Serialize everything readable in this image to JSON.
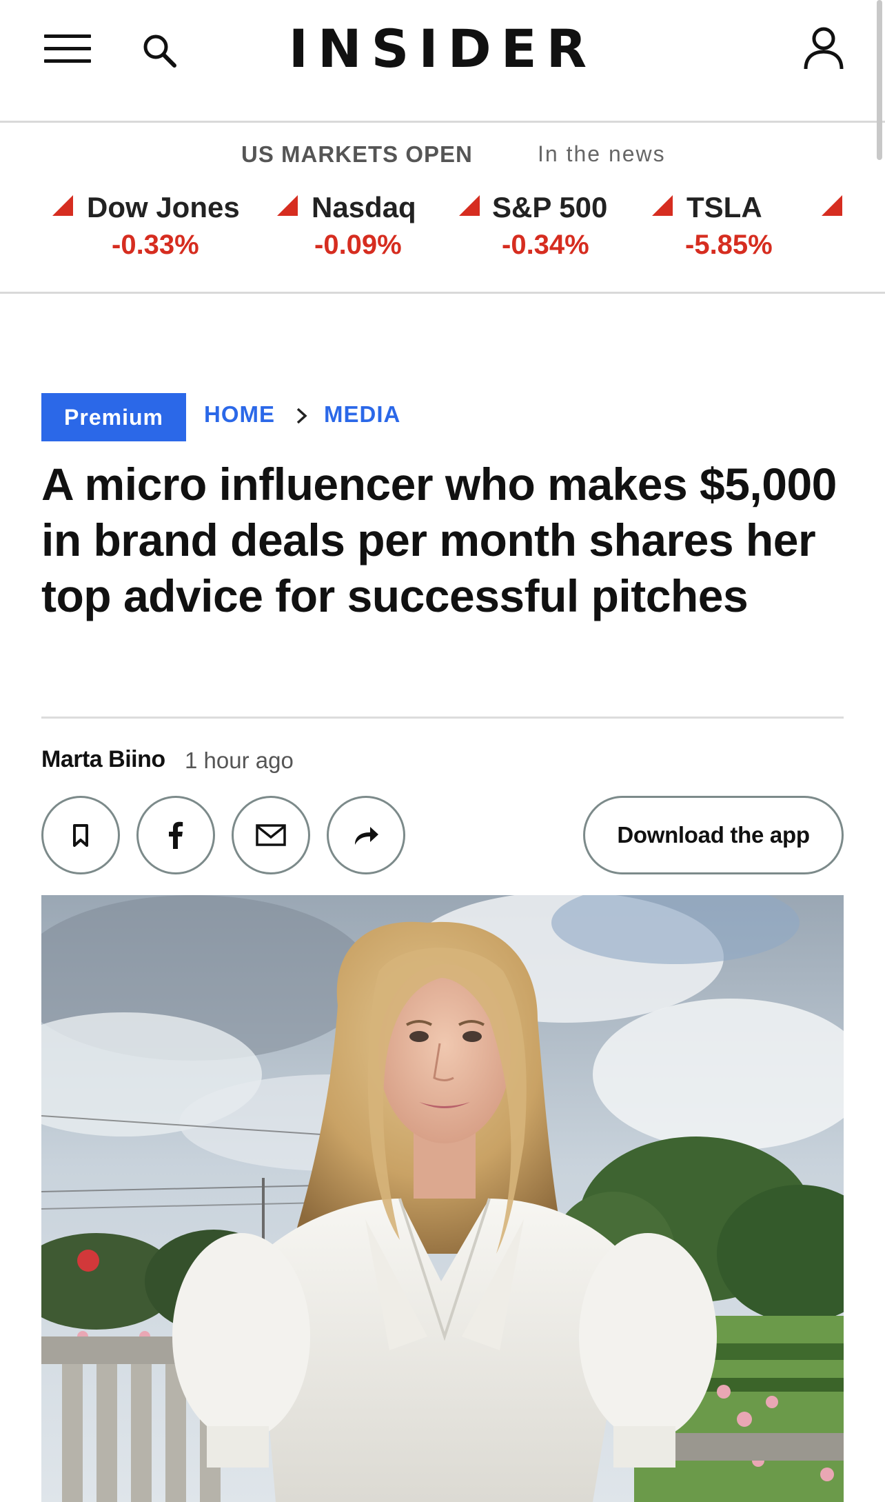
{
  "header": {
    "logo_text": "INSIDER",
    "menu_icon": "hamburger-menu-icon",
    "search_icon": "search-icon",
    "account_icon": "user-account-icon"
  },
  "markets": {
    "status": "US MARKETS OPEN",
    "news_tab": "In the news",
    "tickers": [
      {
        "name": "Dow Jones",
        "change": "-0.33%",
        "direction": "down"
      },
      {
        "name": "Nasdaq",
        "change": "-0.09%",
        "direction": "down"
      },
      {
        "name": "S&P 500",
        "change": "-0.34%",
        "direction": "down"
      },
      {
        "name": "TSLA",
        "change": "-5.85%",
        "direction": "down"
      }
    ],
    "down_color": "#d62d20"
  },
  "article": {
    "badge": "Premium",
    "breadcrumb": [
      "HOME",
      "MEDIA"
    ],
    "headline": "A micro influencer who makes $5,000 in brand deals per month shares her top advice for successful pitches",
    "author": "Marta Biino",
    "time": "1 hour ago",
    "actions": [
      {
        "icon": "bookmark-icon"
      },
      {
        "icon": "facebook-icon"
      },
      {
        "icon": "email-icon"
      },
      {
        "icon": "share-icon"
      }
    ],
    "download_app": "Download the app",
    "accent_color": "#2b68e8",
    "hero_image": "photo of a woman with shoulder-length blonde hair in a white eyelet puff-sleeve dress, standing in a garden with a stone balustrade, trees and a cloudy sky"
  }
}
